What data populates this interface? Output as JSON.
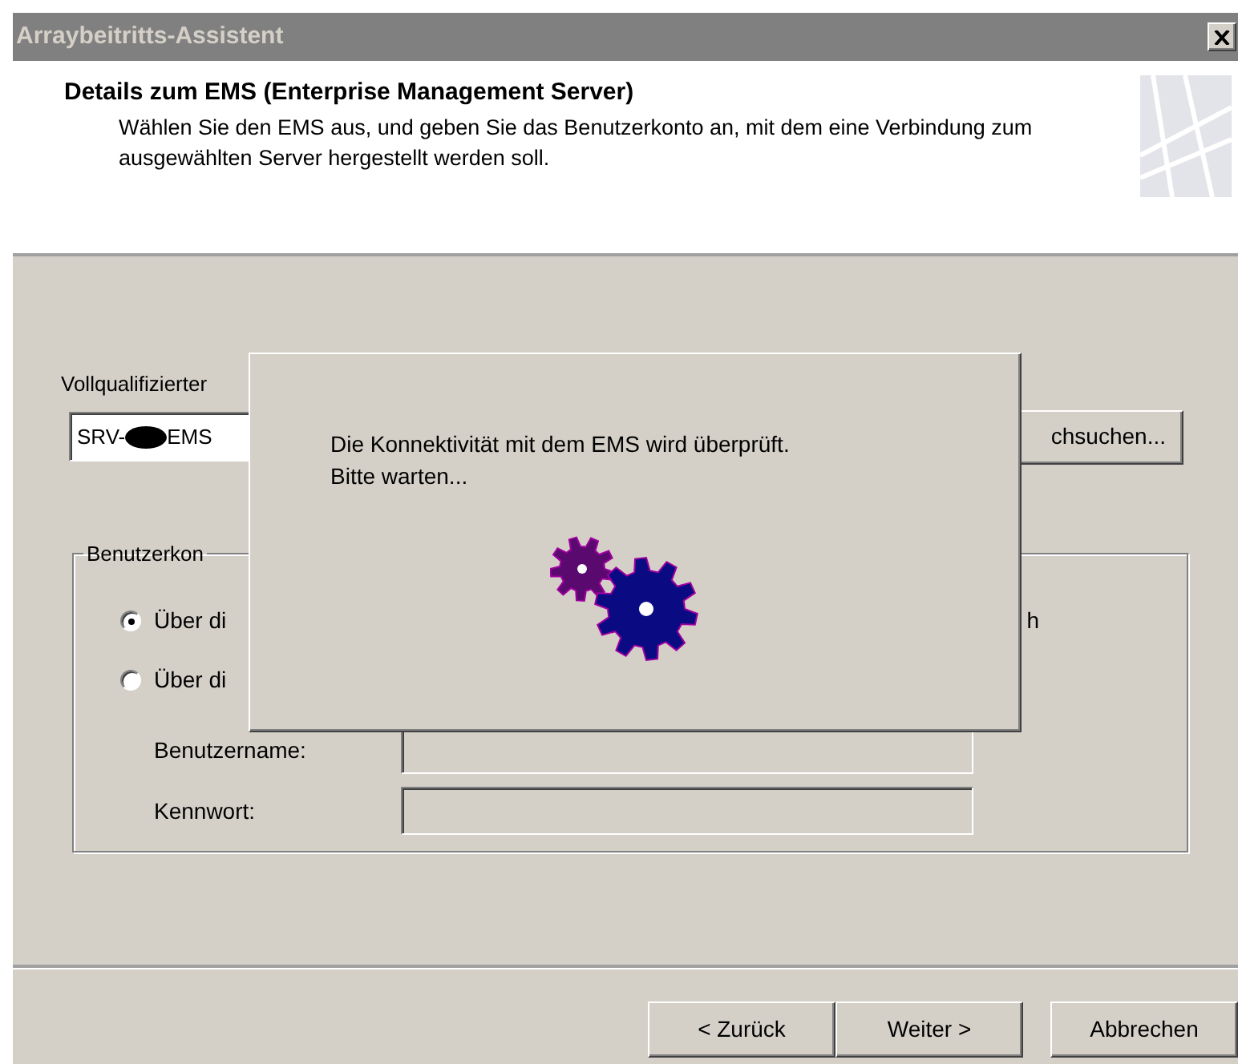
{
  "window": {
    "title": "Arraybeitritts-Assistent"
  },
  "header": {
    "title": "Details zum EMS (Enterprise Management Server)",
    "description": "Wählen Sie den EMS aus, und geben Sie das Benutzerkonto an, mit dem eine Verbindung zum ausgewählten Server hergestellt werden soll."
  },
  "server_field": {
    "label": "Vollqualifizierter",
    "value_parts": [
      "SRV-",
      "EMS"
    ],
    "browse_button": "chsuchen..."
  },
  "account_group": {
    "legend": "Benutzerkon",
    "trailing_fragment": "h",
    "options": [
      {
        "label": "Über di",
        "selected": true
      },
      {
        "label": "Über di",
        "selected": false
      }
    ],
    "fields": [
      {
        "label": "Benutzername:",
        "disabled": true
      },
      {
        "label": "Kennwort:",
        "disabled": true
      }
    ]
  },
  "buttons": [
    {
      "label": "< Zurück"
    },
    {
      "label": "Weiter >"
    },
    {
      "label": "Abbrechen"
    }
  ],
  "progress_dialog": {
    "lines": [
      "Die Konnektivität mit dem EMS wird überprüft.",
      "Bitte warten..."
    ]
  }
}
